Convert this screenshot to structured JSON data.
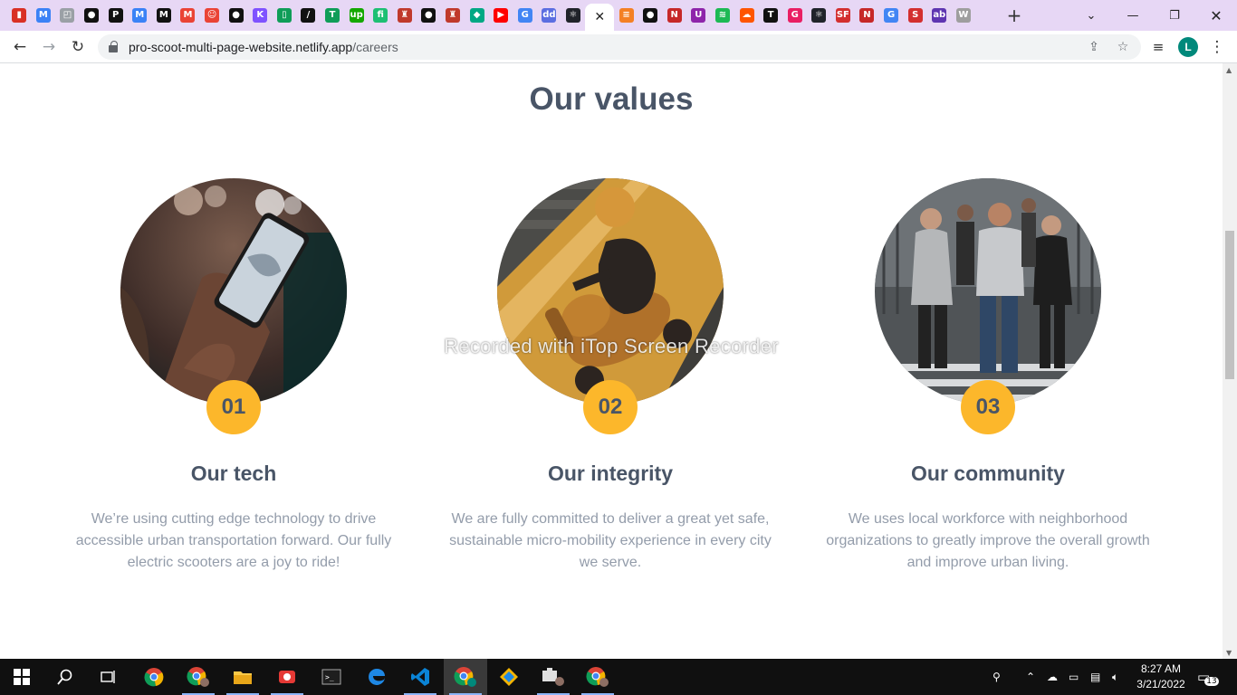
{
  "browser": {
    "tab_favicons": [
      {
        "icon": "bookmark-icon",
        "color": "#d93025",
        "glyph": "▮"
      },
      {
        "icon": "map-icon",
        "color": "#3b82f6",
        "glyph": "M"
      },
      {
        "icon": "doc-icon",
        "color": "#9aa0a6",
        "glyph": "◰"
      },
      {
        "icon": "github-icon",
        "color": "#111111",
        "glyph": "●"
      },
      {
        "icon": "p-icon",
        "color": "#111111",
        "glyph": "P"
      },
      {
        "icon": "map-icon",
        "color": "#3b82f6",
        "glyph": "M"
      },
      {
        "icon": "medium-icon",
        "color": "#111111",
        "glyph": "M"
      },
      {
        "icon": "gmail-icon",
        "color": "#ea4335",
        "glyph": "M"
      },
      {
        "icon": "smile-icon",
        "color": "#ea4335",
        "glyph": "☺"
      },
      {
        "icon": "github-icon",
        "color": "#111111",
        "glyph": "●"
      },
      {
        "icon": "kotlin-icon",
        "color": "#7f52ff",
        "glyph": "K"
      },
      {
        "icon": "phone-icon",
        "color": "#0f9d58",
        "glyph": "▯"
      },
      {
        "icon": "slash-icon",
        "color": "#111111",
        "glyph": "/"
      },
      {
        "icon": "t-icon",
        "color": "#0f9d58",
        "glyph": "T"
      },
      {
        "icon": "upwork-icon",
        "color": "#14a800",
        "glyph": "up"
      },
      {
        "icon": "fiverr-icon",
        "color": "#1dbf73",
        "glyph": "fi"
      },
      {
        "icon": "crest-icon",
        "color": "#c0392b",
        "glyph": "♜"
      },
      {
        "icon": "github-icon",
        "color": "#111111",
        "glyph": "●"
      },
      {
        "icon": "crest-icon",
        "color": "#c0392b",
        "glyph": "♜"
      },
      {
        "icon": "diamond-icon",
        "color": "#00a884",
        "glyph": "◆"
      },
      {
        "icon": "youtube-icon",
        "color": "#ff0000",
        "glyph": "▶"
      },
      {
        "icon": "google-icon",
        "color": "#4285f4",
        "glyph": "G"
      },
      {
        "icon": "dnd-icon",
        "color": "#5b6ee1",
        "glyph": "dd"
      },
      {
        "icon": "react-icon",
        "color": "#20232a",
        "glyph": "⚛"
      }
    ],
    "active_tab_close": "✕",
    "tab_favicons_right": [
      {
        "icon": "stack-icon",
        "color": "#f48024",
        "glyph": "≡"
      },
      {
        "icon": "github-icon",
        "color": "#111111",
        "glyph": "●"
      },
      {
        "icon": "netlify-icon",
        "color": "#c62828",
        "glyph": "N"
      },
      {
        "icon": "u-icon",
        "color": "#8e24aa",
        "glyph": "U"
      },
      {
        "icon": "spotify-icon",
        "color": "#1db954",
        "glyph": "≋"
      },
      {
        "icon": "soundcloud-icon",
        "color": "#ff5500",
        "glyph": "☁"
      },
      {
        "icon": "t-icon",
        "color": "#111111",
        "glyph": "T"
      },
      {
        "icon": "gem-icon",
        "color": "#e91e63",
        "glyph": "G"
      },
      {
        "icon": "react-icon",
        "color": "#20232a",
        "glyph": "⚛"
      },
      {
        "icon": "sf-icon",
        "color": "#d32f2f",
        "glyph": "SF"
      },
      {
        "icon": "netlify-icon",
        "color": "#c62828",
        "glyph": "N"
      },
      {
        "icon": "google-icon",
        "color": "#4285f4",
        "glyph": "G"
      },
      {
        "icon": "s-icon",
        "color": "#d32f2f",
        "glyph": "S"
      },
      {
        "icon": "ableton-icon",
        "color": "#5e35b1",
        "glyph": "ab"
      },
      {
        "icon": "wordpress-icon",
        "color": "#9e9e9e",
        "glyph": "W"
      }
    ],
    "new_tab": "+",
    "url_host": "pro-scoot-multi-page-website.netlify.app",
    "url_path": "/careers",
    "profile_initial": "L"
  },
  "page": {
    "section_title": "Our values",
    "watermark": "Recorded with iTop Screen Recorder",
    "cards": [
      {
        "number": "01",
        "title": "Our tech",
        "text": "We’re using cutting edge technology to drive accessible urban transportation forward. Our fully electric scooters are a joy to ride!"
      },
      {
        "number": "02",
        "title": "Our integrity",
        "text": "We are fully committed to deliver a great yet safe, sustainable micro-mobility experience in every city we serve."
      },
      {
        "number": "03",
        "title": "Our community",
        "text": "We uses local workforce with neighborhood organizations to greatly improve the overall growth and improve urban living."
      }
    ],
    "accent_color": "#fcb72b",
    "heading_color": "#495567",
    "body_color": "#939caa"
  },
  "taskbar": {
    "time": "8:27 AM",
    "date": "3/21/2022",
    "notification_count": "13"
  }
}
